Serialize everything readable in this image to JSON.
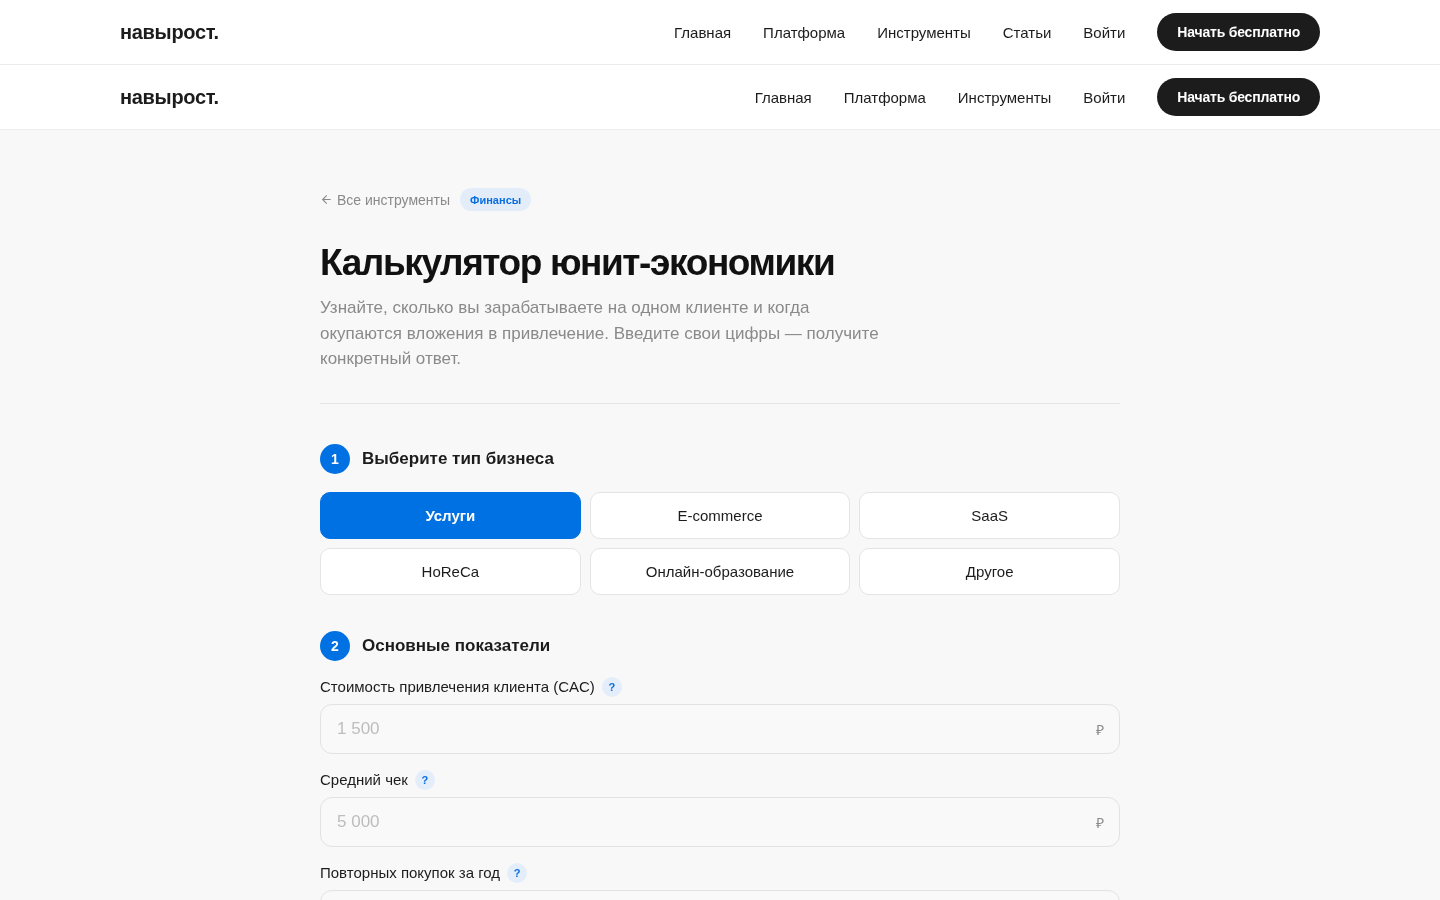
{
  "headers": [
    {
      "logo": "навырост.",
      "nav": [
        "Главная",
        "Платформа",
        "Инструменты",
        "Статьи",
        "Войти"
      ],
      "cta": "Начать бесплатно"
    },
    {
      "logo": "навырост.",
      "nav": [
        "Главная",
        "Платформа",
        "Инструменты",
        "Войти"
      ],
      "cta": "Начать бесплатно"
    }
  ],
  "breadcrumb": {
    "back_link": "Все инструменты",
    "tag": "Финансы"
  },
  "title": "Калькулятор юнит-экономики",
  "subtitle": "Узнайте, сколько вы зарабатываете на одном клиенте и когда окупаются вложения в привлечение. Введите свои цифры — получите конкретный ответ.",
  "steps": [
    {
      "number": "1",
      "title": "Выберите тип бизнеса",
      "kind": "options",
      "options": [
        {
          "label": "Услуги",
          "selected": true
        },
        {
          "label": "E-commerce",
          "selected": false
        },
        {
          "label": "SaaS",
          "selected": false
        },
        {
          "label": "HoReCa",
          "selected": false
        },
        {
          "label": "Онлайн-образование",
          "selected": false
        },
        {
          "label": "Другое",
          "selected": false
        }
      ]
    },
    {
      "number": "2",
      "title": "Основные показатели",
      "kind": "fields",
      "fields": [
        {
          "label": "Стоимость привлечения клиента (CAC)",
          "help": "?",
          "placeholder": "1 500",
          "unit": "₽"
        },
        {
          "label": "Средний чек",
          "help": "?",
          "placeholder": "5 000",
          "unit": "₽"
        },
        {
          "label": "Повторных покупок за год",
          "help": "?"
        }
      ]
    }
  ]
}
